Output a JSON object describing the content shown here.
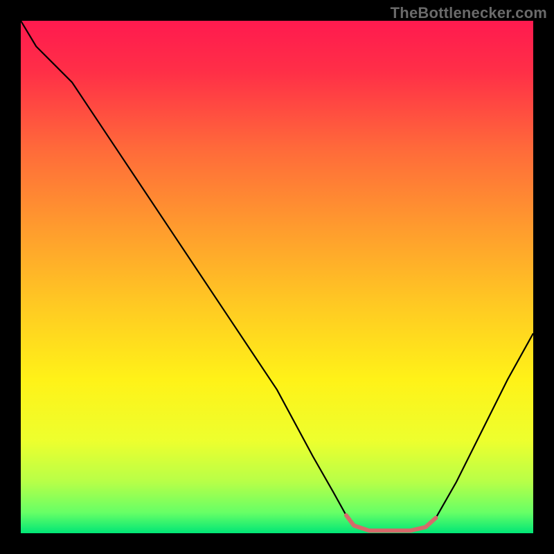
{
  "watermark": "TheBottlenecker.com",
  "chart_data": {
    "type": "line",
    "title": "",
    "xlabel": "",
    "ylabel": "",
    "x_range": [
      0,
      100
    ],
    "y_range": [
      0,
      100
    ],
    "background_gradient_stops": [
      {
        "offset": 0.0,
        "color": "#ff1a4f"
      },
      {
        "offset": 0.1,
        "color": "#ff2f47"
      },
      {
        "offset": 0.25,
        "color": "#ff6a3a"
      },
      {
        "offset": 0.4,
        "color": "#ff9a2e"
      },
      {
        "offset": 0.55,
        "color": "#ffc823"
      },
      {
        "offset": 0.7,
        "color": "#fff218"
      },
      {
        "offset": 0.82,
        "color": "#edff2e"
      },
      {
        "offset": 0.9,
        "color": "#b7ff48"
      },
      {
        "offset": 0.96,
        "color": "#66ff66"
      },
      {
        "offset": 1.0,
        "color": "#00e676"
      }
    ],
    "series": [
      {
        "name": "main-curve",
        "color": "#000000",
        "width": 2.2,
        "points": [
          {
            "x": 0,
            "y": 100
          },
          {
            "x": 3,
            "y": 95
          },
          {
            "x": 6,
            "y": 92
          },
          {
            "x": 10,
            "y": 88
          },
          {
            "x": 20,
            "y": 73
          },
          {
            "x": 30,
            "y": 58
          },
          {
            "x": 40,
            "y": 43
          },
          {
            "x": 50,
            "y": 28
          },
          {
            "x": 57,
            "y": 15
          },
          {
            "x": 61,
            "y": 8
          },
          {
            "x": 63.5,
            "y": 3.5
          },
          {
            "x": 65,
            "y": 1.5
          },
          {
            "x": 68,
            "y": 0.5
          },
          {
            "x": 72,
            "y": 0.5
          },
          {
            "x": 76,
            "y": 0.5
          },
          {
            "x": 79,
            "y": 1.2
          },
          {
            "x": 81,
            "y": 3
          },
          {
            "x": 85,
            "y": 10
          },
          {
            "x": 90,
            "y": 20
          },
          {
            "x": 95,
            "y": 30
          },
          {
            "x": 100,
            "y": 39
          }
        ]
      },
      {
        "name": "highlight-band",
        "color": "#d66a6a",
        "width": 6,
        "points": [
          {
            "x": 63.5,
            "y": 3.5
          },
          {
            "x": 65,
            "y": 1.5
          },
          {
            "x": 68,
            "y": 0.5
          },
          {
            "x": 72,
            "y": 0.5
          },
          {
            "x": 76,
            "y": 0.5
          },
          {
            "x": 79,
            "y": 1.2
          },
          {
            "x": 81,
            "y": 3
          }
        ]
      }
    ]
  }
}
